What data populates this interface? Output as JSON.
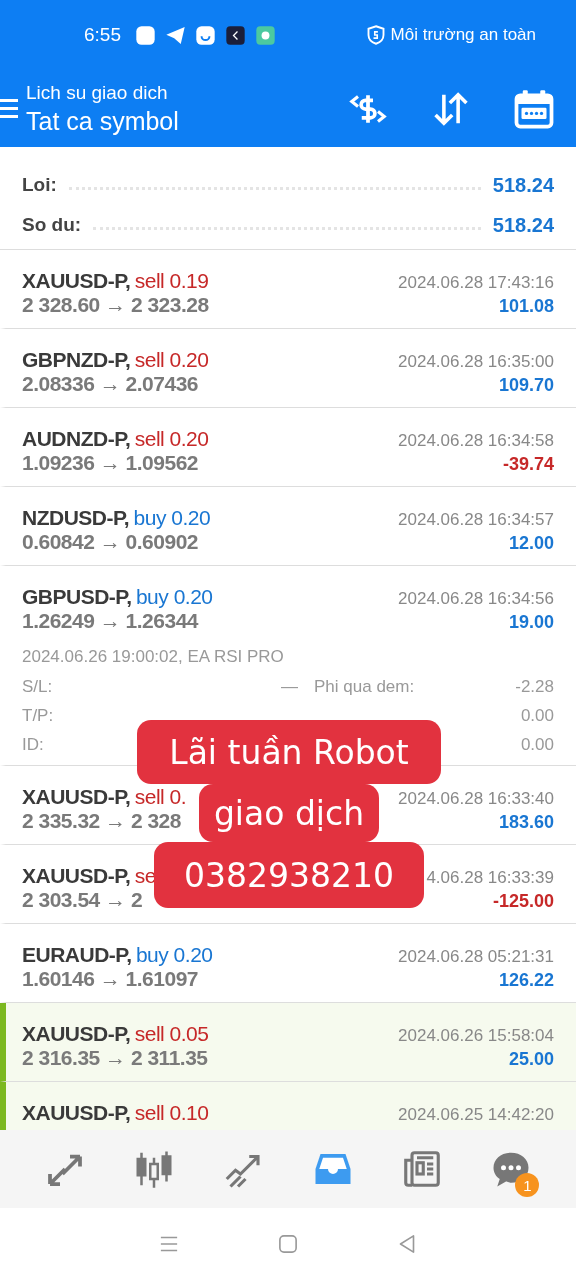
{
  "status_bar": {
    "time": "6:55",
    "security": "Môi trường an toàn"
  },
  "header": {
    "subtitle": "Lich su giao dich",
    "title": "Tat ca symbol"
  },
  "summary": [
    {
      "label": "Loi:",
      "value": "518.24"
    },
    {
      "label": "So du:",
      "value": "518.24"
    }
  ],
  "deals": [
    {
      "symbol": "XAUUSD-P,",
      "sell": true,
      "order": "sell 0.19",
      "prices": "2 328.60 → 2 323.28",
      "time": "2024.06.28 17:43:16",
      "profit": "101.08",
      "loss": false,
      "highlighted": false
    },
    {
      "symbol": "GBPNZD-P,",
      "sell": true,
      "order": "sell 0.20",
      "prices": "2.08336 → 2.07436",
      "time": "2024.06.28 16:35:00",
      "profit": "109.70",
      "loss": false,
      "highlighted": false
    },
    {
      "symbol": "AUDNZD-P,",
      "sell": true,
      "order": "sell 0.20",
      "prices": "1.09236 → 1.09562",
      "time": "2024.06.28 16:34:58",
      "profit": "-39.74",
      "loss": true,
      "highlighted": false
    },
    {
      "symbol": "NZDUSD-P,",
      "sell": false,
      "order": "buy 0.20",
      "prices": "0.60842 → 0.60902",
      "time": "2024.06.28 16:34:57",
      "profit": "12.00",
      "loss": false,
      "highlighted": false
    },
    {
      "symbol": "GBPUSD-P,",
      "sell": false,
      "order": "buy 0.20",
      "prices": "1.26249 → 1.26344",
      "time": "2024.06.28 16:34:56",
      "profit": "19.00",
      "loss": false,
      "highlighted": false,
      "details": {
        "opened": "2024.06.26 19:00:02, EA RSI PRO",
        "rows": [
          {
            "left_label": "S/L:",
            "left_value": "—",
            "right_label": "Phi qua dem:",
            "right_value": "-2.28"
          },
          {
            "left_label": "T/P:",
            "right_value": "0.00"
          },
          {
            "left_label": "ID:",
            "right_value": "0.00"
          }
        ]
      }
    },
    {
      "symbol": "XAUUSD-P,",
      "sell": true,
      "order": "sell 0.",
      "prices": "2 335.32 → 2 328",
      "time": "2024.06.28 16:33:40",
      "profit": "183.60",
      "loss": false,
      "highlighted": false
    },
    {
      "symbol": "XAUUSD-P,",
      "sell": true,
      "order": "se",
      "prices": "2 303.54 → 2",
      "time": "4.06.28 16:33:39",
      "profit": "-125.00",
      "loss": true,
      "highlighted": false
    },
    {
      "symbol": "EURAUD-P,",
      "sell": false,
      "order": "buy 0.20",
      "prices": "1.60146 → 1.61097",
      "time": "2024.06.28 05:21:31",
      "profit": "126.22",
      "loss": false,
      "highlighted": false
    },
    {
      "symbol": "XAUUSD-P,",
      "sell": true,
      "order": "sell 0.05",
      "prices": "2 316.35 → 2 311.35",
      "time": "2024.06.26 15:58:04",
      "profit": "25.00",
      "loss": false,
      "highlighted": true
    },
    {
      "symbol": "XAUUSD-P,",
      "sell": true,
      "order": "sell 0.10",
      "time": "2024.06.25 14:42:20",
      "highlighted": true
    }
  ],
  "sticker": {
    "lines": [
      "Lãi tuần Robot",
      "giao dịch",
      "0382938210"
    ]
  },
  "nav_tabs": [
    {
      "kind": "trade",
      "selected": false
    },
    {
      "kind": "chart",
      "selected": false
    },
    {
      "kind": "trend",
      "selected": false
    },
    {
      "kind": "history",
      "selected": true
    },
    {
      "kind": "news",
      "selected": false
    },
    {
      "kind": "chat",
      "selected": false,
      "badge": "1"
    }
  ]
}
